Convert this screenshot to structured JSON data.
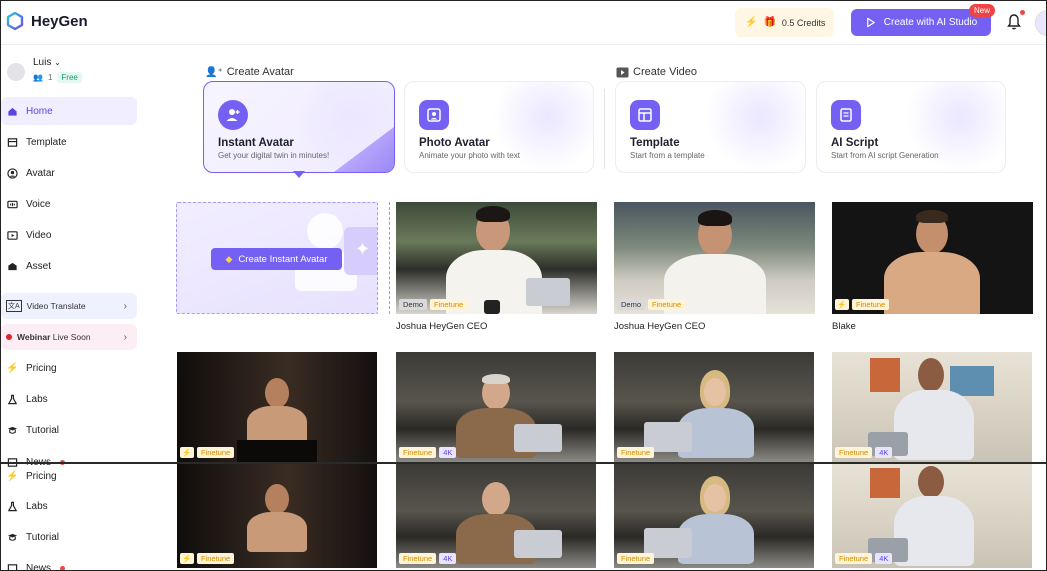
{
  "brand": {
    "name": "HeyGen"
  },
  "topbar": {
    "credits_label": "0.5 Credits",
    "studio_button": "Create with AI Studio",
    "new_badge": "New"
  },
  "user": {
    "name": "Luis",
    "seats": "1",
    "plan": "Free"
  },
  "sidebar": {
    "items": [
      {
        "label": "Home",
        "icon": "home-icon"
      },
      {
        "label": "Template",
        "icon": "template-icon"
      },
      {
        "label": "Avatar",
        "icon": "avatar-icon"
      },
      {
        "label": "Voice",
        "icon": "voice-icon"
      },
      {
        "label": "Video",
        "icon": "video-icon"
      },
      {
        "label": "Asset",
        "icon": "asset-icon"
      }
    ],
    "video_translate": "Video Translate",
    "webinar_bold": "Webinar",
    "webinar_rest": " Live Soon",
    "bottom_items": [
      {
        "label": "Pricing",
        "icon": "pricing-icon"
      },
      {
        "label": "Labs",
        "icon": "labs-icon"
      },
      {
        "label": "Tutorial",
        "icon": "tutorial-icon"
      },
      {
        "label": "News",
        "icon": "news-icon"
      }
    ],
    "bottom_items_repeat": [
      {
        "label": "Pricing"
      },
      {
        "label": "Labs"
      },
      {
        "label": "Tutorial"
      },
      {
        "label": "News"
      }
    ]
  },
  "create_avatar": {
    "section_title": "Create Avatar",
    "cards": [
      {
        "title": "Instant Avatar",
        "subtitle": "Get your digital twin in minutes!"
      },
      {
        "title": "Photo Avatar",
        "subtitle": "Animate your photo with text"
      }
    ]
  },
  "create_video": {
    "section_title": "Create Video",
    "cards": [
      {
        "title": "Template",
        "subtitle": "Start from a template"
      },
      {
        "title": "AI Script",
        "subtitle": "Start from AI script Generation"
      }
    ]
  },
  "instant_tile": {
    "button_label": "Create Instant Avatar"
  },
  "tags": {
    "demo": "Demo",
    "finetune": "Finetune",
    "k4": "4K"
  },
  "avatars_row1": [
    {
      "name": "Joshua HeyGen CEO"
    },
    {
      "name": "Joshua HeyGen CEO"
    },
    {
      "name": "Blake"
    }
  ]
}
